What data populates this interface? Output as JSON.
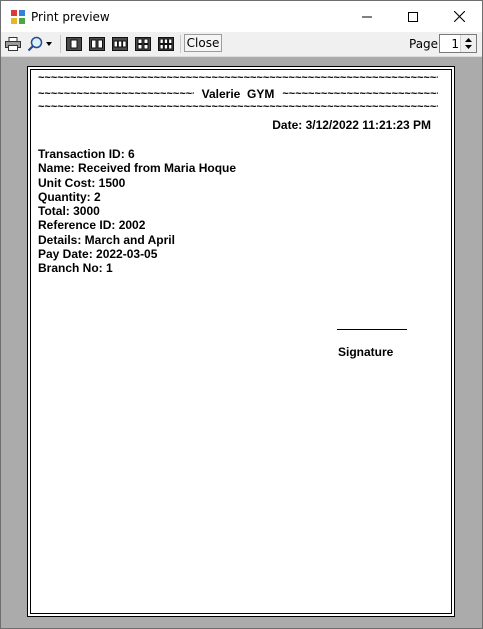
{
  "window": {
    "title": "Print preview"
  },
  "toolbar": {
    "close_label": "Close",
    "page_label": "Page",
    "page_value": "1",
    "buttons": [
      "print-icon",
      "zoom-icon",
      "one-page-icon",
      "two-pages-icon",
      "three-pages-icon",
      "four-pages-icon",
      "six-pages-icon"
    ]
  },
  "document": {
    "tilde_row": "~~~~~~~~~~~~~~~~~~~~~~~~~~~~~~~~~~~~~~~~~~~~~~~~~~~~~~~~~~~~~~~~~~~~~~~~~~~~~~~~~~~~~",
    "gym_name": "Valerie  GYM",
    "date": "Date: 3/12/2022 11:21:23 PM",
    "fields": [
      "Transaction ID: 6",
      "Name: Received from Maria Hoque",
      "Unit Cost: 1500",
      "Quantity: 2",
      "Total: 3000",
      "Reference ID: 2002",
      "Details: March and April",
      "Pay Date: 2022-03-05",
      "Branch No: 1"
    ],
    "signature_label": "Signature"
  },
  "colors": {
    "viewport_bg": "#ababab",
    "toolbar_bg": "#f0f0f0"
  }
}
